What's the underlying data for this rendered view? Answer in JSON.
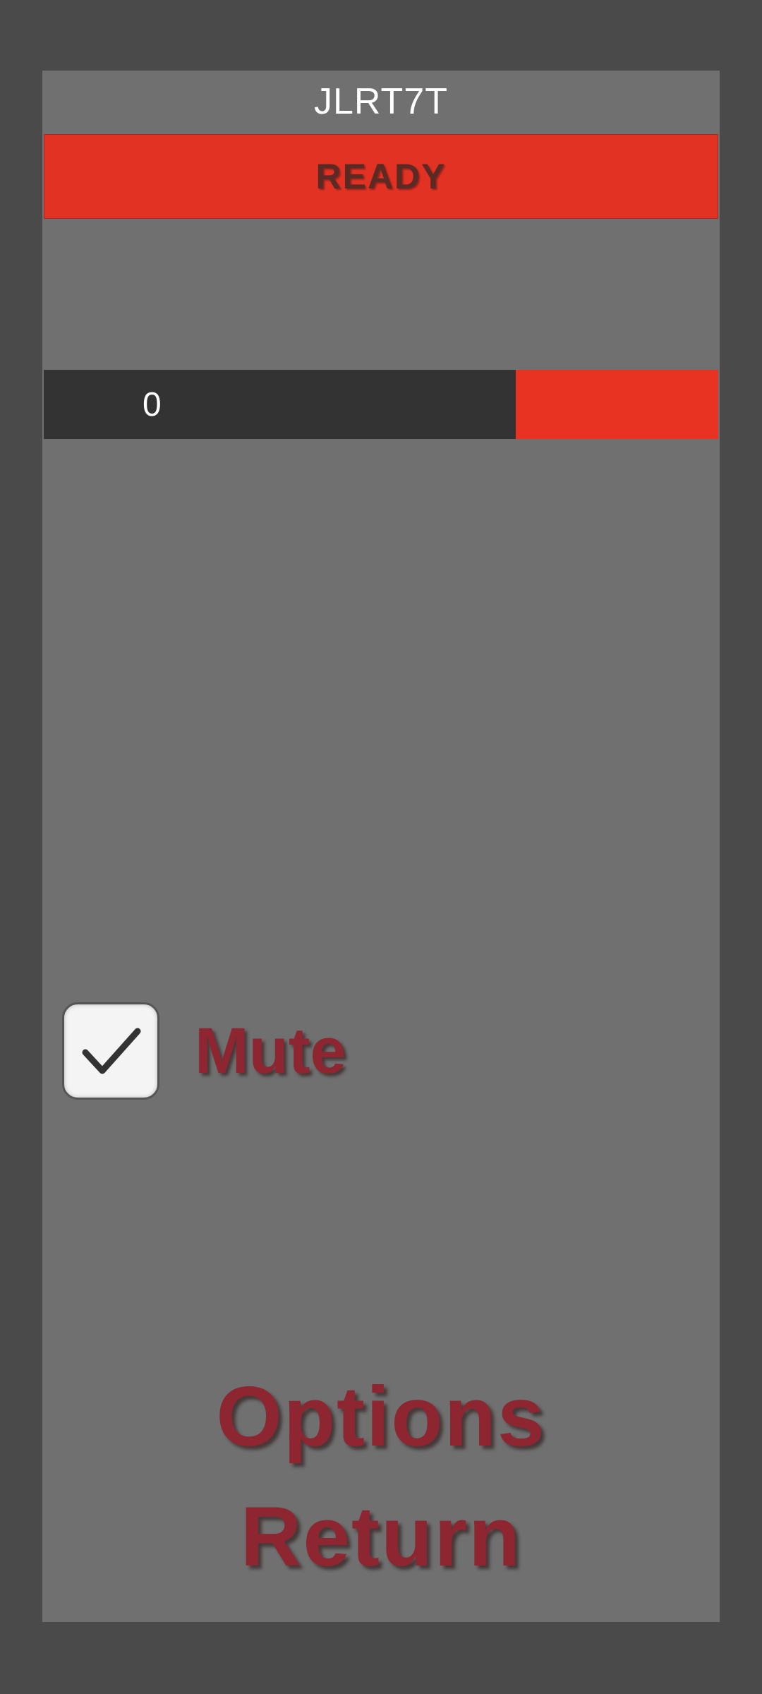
{
  "title": "JLRT7T",
  "ready_button": {
    "label": "READY",
    "color": "#e23224"
  },
  "progress": {
    "value": "0",
    "fill_fraction": 0.7,
    "dark_color": "#333333",
    "remaining_color": "#e83222"
  },
  "mute": {
    "label": "Mute",
    "checked": true,
    "checkbox_icon": "check-icon"
  },
  "menu": {
    "options_label": "Options",
    "return_label": "Return"
  },
  "colors": {
    "background": "#4a4a4a",
    "panel": "#707070",
    "text_accent": "#8d2630"
  }
}
